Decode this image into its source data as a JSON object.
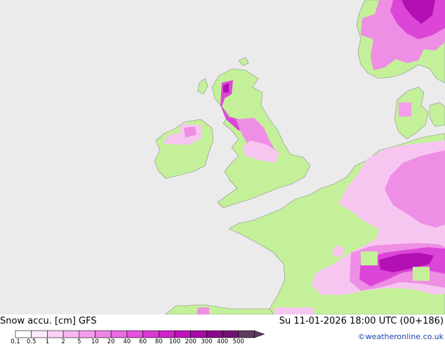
{
  "map": {
    "title": "Snow accu. [cm] GFS",
    "valid_time": "Su 11-01-2026 18:00 UTC (00+186)",
    "credit": "©weatheronline.co.uk",
    "colors": {
      "sea": "#ebebeb",
      "land": "#c4f09a",
      "coast": "#8c8c8c",
      "snow_light": "#f7c6f0",
      "snow_mid": "#ee8ee4",
      "snow_heavy": "#dc46d6",
      "snow_max": "#b20fb4"
    },
    "legend": {
      "labels": [
        "0.1",
        "0.5",
        "1",
        "2",
        "5",
        "10",
        "20",
        "40",
        "60",
        "80",
        "100",
        "200",
        "300",
        "400",
        "500"
      ],
      "colors": [
        "#ffffff",
        "#fde9fb",
        "#fbd0f6",
        "#f8b6f1",
        "#f49ded",
        "#f084e8",
        "#ec6ae3",
        "#e650de",
        "#dc38d6",
        "#cf24cb",
        "#bf12bd",
        "#a80aa5",
        "#8c078b",
        "#721070",
        "#5e3b5e"
      ]
    }
  }
}
